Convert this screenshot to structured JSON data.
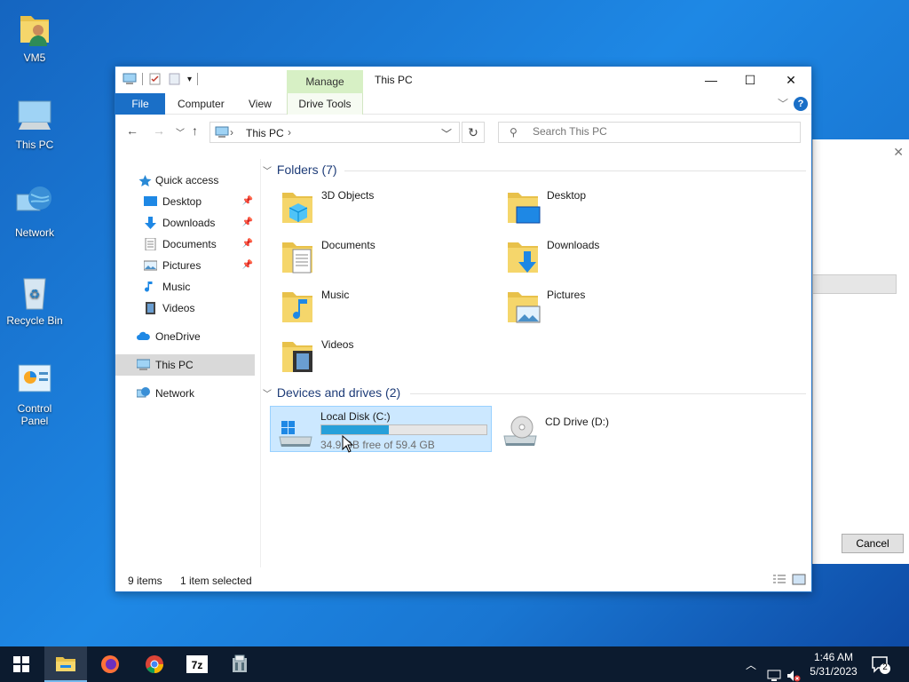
{
  "desktop": {
    "icons": [
      {
        "label": "VM5"
      },
      {
        "label": "This PC"
      },
      {
        "label": "Network"
      },
      {
        "label": "Recycle Bin"
      },
      {
        "label": "Control Panel"
      }
    ]
  },
  "background_dialog": {
    "cancel_label": "Cancel"
  },
  "window": {
    "title": "This PC",
    "contextual_tab_group": "Manage",
    "ribbon_tabs": [
      "File",
      "Computer",
      "View",
      "Drive Tools"
    ],
    "address": {
      "location": "This PC"
    },
    "search": {
      "placeholder": "Search This PC"
    },
    "navigation": {
      "items": [
        {
          "label": "Quick access",
          "icon": "star-icon",
          "pinned": false
        },
        {
          "label": "Desktop",
          "icon": "desktop-folder-icon",
          "pinned": true
        },
        {
          "label": "Downloads",
          "icon": "download-arrow-icon",
          "pinned": true
        },
        {
          "label": "Documents",
          "icon": "document-icon",
          "pinned": true
        },
        {
          "label": "Pictures",
          "icon": "pictures-icon",
          "pinned": true
        },
        {
          "label": "Music",
          "icon": "music-note-icon",
          "pinned": false
        },
        {
          "label": "Videos",
          "icon": "film-icon",
          "pinned": false
        },
        {
          "label": "OneDrive",
          "icon": "cloud-icon",
          "pinned": false
        },
        {
          "label": "This PC",
          "icon": "computer-icon",
          "pinned": false,
          "selected": true
        },
        {
          "label": "Network",
          "icon": "network-icon",
          "pinned": false
        }
      ]
    },
    "folders_group": {
      "header": "Folders (7)",
      "items": [
        {
          "label": "3D Objects",
          "icon": "3d-objects-folder-icon"
        },
        {
          "label": "Desktop",
          "icon": "desktop-folder-icon"
        },
        {
          "label": "Documents",
          "icon": "documents-folder-icon"
        },
        {
          "label": "Downloads",
          "icon": "downloads-folder-icon"
        },
        {
          "label": "Music",
          "icon": "music-folder-icon"
        },
        {
          "label": "Pictures",
          "icon": "pictures-folder-icon"
        },
        {
          "label": "Videos",
          "icon": "videos-folder-icon"
        }
      ]
    },
    "drives_group": {
      "header": "Devices and drives (2)",
      "items": [
        {
          "label": "Local Disk (C:)",
          "free_text": "34.9 GB free of 59.4 GB",
          "used_fraction": 0.41,
          "selected": true,
          "icon": "windows-drive-icon"
        },
        {
          "label": "CD Drive (D:)",
          "icon": "cd-drive-icon"
        }
      ]
    },
    "status": {
      "items_count": "9 items",
      "selection": "1 item selected"
    }
  },
  "taskbar": {
    "apps": [
      "file-explorer-icon",
      "firefox-icon",
      "chrome-icon",
      "7zip-icon",
      "app-icon"
    ],
    "clock": {
      "time": "1:46 AM",
      "date": "5/31/2023"
    },
    "notifications_count": "2"
  },
  "colors": {
    "accent": "#1a6fc7",
    "selection": "#cce8ff",
    "drive_bar": "#26a0da",
    "manage_tab": "#d7f0c5"
  }
}
